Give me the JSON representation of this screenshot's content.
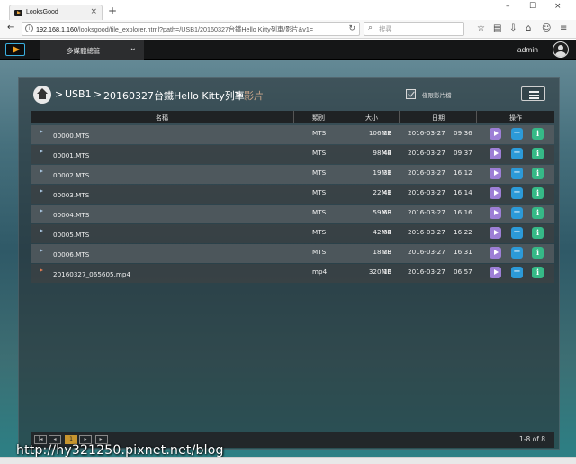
{
  "browser": {
    "tab_title": "LooksGood",
    "tab_close": "×",
    "new_tab": "+",
    "window_controls": [
      "–",
      "☐",
      "×"
    ],
    "url_host": "192.168.1.160",
    "url_path": "/looksgood/file_explorer.html?path=/USB1/20160327台鐵Hello Kitty列車/影片&v1=",
    "search_placeholder": "搜尋"
  },
  "app": {
    "menu_label": "多媒體總管",
    "user": "admin"
  },
  "breadcrumb": {
    "items": [
      "USB1",
      "20160327台鐵Hello Kitty列車",
      "影片"
    ],
    "separator": ">"
  },
  "options": {
    "video_only_label": "僅限影片檔",
    "video_only_checked": true
  },
  "table": {
    "headers": {
      "name": "名稱",
      "type": "類別",
      "size": "大小",
      "date": "日期",
      "actions": "操作"
    },
    "rows": [
      {
        "name": "00000.MTS",
        "type": "MTS",
        "size": "106.22",
        "unit": "MB",
        "date": "2016-03-27",
        "time": "09:36",
        "kind": "mts"
      },
      {
        "name": "00001.MTS",
        "type": "MTS",
        "size": "98.44",
        "unit": "MB",
        "date": "2016-03-27",
        "time": "09:37",
        "kind": "mts"
      },
      {
        "name": "00002.MTS",
        "type": "MTS",
        "size": "19.31",
        "unit": "MB",
        "date": "2016-03-27",
        "time": "16:12",
        "kind": "mts"
      },
      {
        "name": "00003.MTS",
        "type": "MTS",
        "size": "22.41",
        "unit": "MB",
        "date": "2016-03-27",
        "time": "16:14",
        "kind": "mts"
      },
      {
        "name": "00004.MTS",
        "type": "MTS",
        "size": "59.63",
        "unit": "MB",
        "date": "2016-03-27",
        "time": "16:16",
        "kind": "mts"
      },
      {
        "name": "00005.MTS",
        "type": "MTS",
        "size": "42.84",
        "unit": "MB",
        "date": "2016-03-27",
        "time": "16:22",
        "kind": "mts"
      },
      {
        "name": "00006.MTS",
        "type": "MTS",
        "size": "18.28",
        "unit": "MB",
        "date": "2016-03-27",
        "time": "16:31",
        "kind": "mts"
      },
      {
        "name": "20160327_065605.mp4",
        "type": "mp4",
        "size": "320.16",
        "unit": "MB",
        "date": "2016-03-27",
        "time": "06:57",
        "kind": "mp4"
      }
    ],
    "action_add": "+",
    "action_info": "i"
  },
  "pagination": {
    "buttons": [
      "|◂",
      "◂",
      "1",
      "▸",
      "▸|"
    ],
    "current_page": "1",
    "count_label": "1-8 of 8"
  },
  "watermark": "http://hy321250.pixnet.net/blog"
}
